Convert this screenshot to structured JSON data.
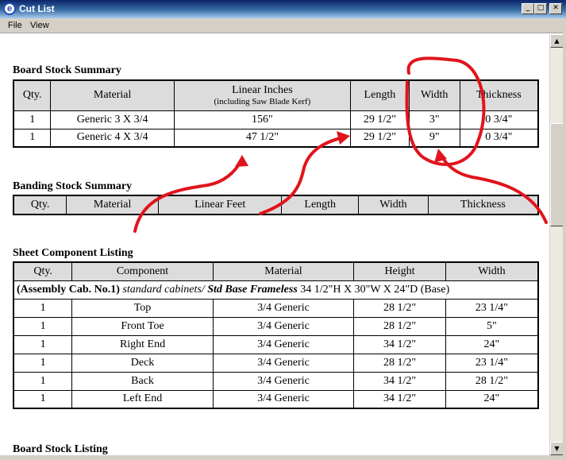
{
  "window": {
    "app_icon_glyph": "e",
    "title": "Cut List",
    "minimize_glyph": "_",
    "maximize_glyph": "□",
    "close_glyph": "✕"
  },
  "menu": {
    "file": "File",
    "view": "View"
  },
  "scrollbar": {
    "up_glyph": "▲",
    "down_glyph": "▼"
  },
  "board_summary": {
    "title": "Board Stock Summary",
    "headers": {
      "qty": "Qty.",
      "material": "Material",
      "linear_inches": "Linear Inches",
      "linear_inches_sub": "(including Saw Blade Kerf)",
      "length": "Length",
      "width": "Width",
      "thickness": "Thickness"
    },
    "rows": [
      {
        "qty": "1",
        "material": "Generic 3 X 3/4",
        "linear": "156\"",
        "length": "29 1/2\"",
        "width": "3\"",
        "thickness": "0 3/4\""
      },
      {
        "qty": "1",
        "material": "Generic 4 X 3/4",
        "linear": "47 1/2\"",
        "length": "29 1/2\"",
        "width": "9\"",
        "thickness": "0 3/4\""
      }
    ]
  },
  "banding_summary": {
    "title": "Banding Stock Summary",
    "headers": {
      "qty": "Qty.",
      "material": "Material",
      "linear_feet": "Linear Feet",
      "length": "Length",
      "width": "Width",
      "thickness": "Thickness"
    }
  },
  "sheet_listing": {
    "title": "Sheet Component Listing",
    "headers": {
      "qty": "Qty.",
      "component": "Component",
      "material": "Material",
      "height": "Height",
      "width": "Width"
    },
    "group": {
      "name": "(Assembly Cab. No.1)",
      "path": "standard cabinets/",
      "style": "Std Base Frameless",
      "dims": "34 1/2\"H X 30\"W X 24\"D  (Base)"
    },
    "rows": [
      {
        "qty": "1",
        "component": "Top",
        "material": "3/4 Generic",
        "height": "28 1/2\"",
        "width": "23 1/4\""
      },
      {
        "qty": "1",
        "component": "Front Toe",
        "material": "3/4 Generic",
        "height": "28 1/2\"",
        "width": "5\""
      },
      {
        "qty": "1",
        "component": "Right End",
        "material": "3/4 Generic",
        "height": "34 1/2\"",
        "width": "24\""
      },
      {
        "qty": "1",
        "component": "Deck",
        "material": "3/4 Generic",
        "height": "28 1/2\"",
        "width": "23 1/4\""
      },
      {
        "qty": "1",
        "component": "Back",
        "material": "3/4 Generic",
        "height": "34 1/2\"",
        "width": "28 1/2\""
      },
      {
        "qty": "1",
        "component": "Left End",
        "material": "3/4 Generic",
        "height": "34 1/2\"",
        "width": "24\""
      }
    ]
  },
  "board_listing": {
    "title": "Board Stock Listing"
  },
  "colors": {
    "annotation": "#e0141c",
    "header_fill": "#dcdcdc",
    "titlebar": "#0a246a"
  }
}
